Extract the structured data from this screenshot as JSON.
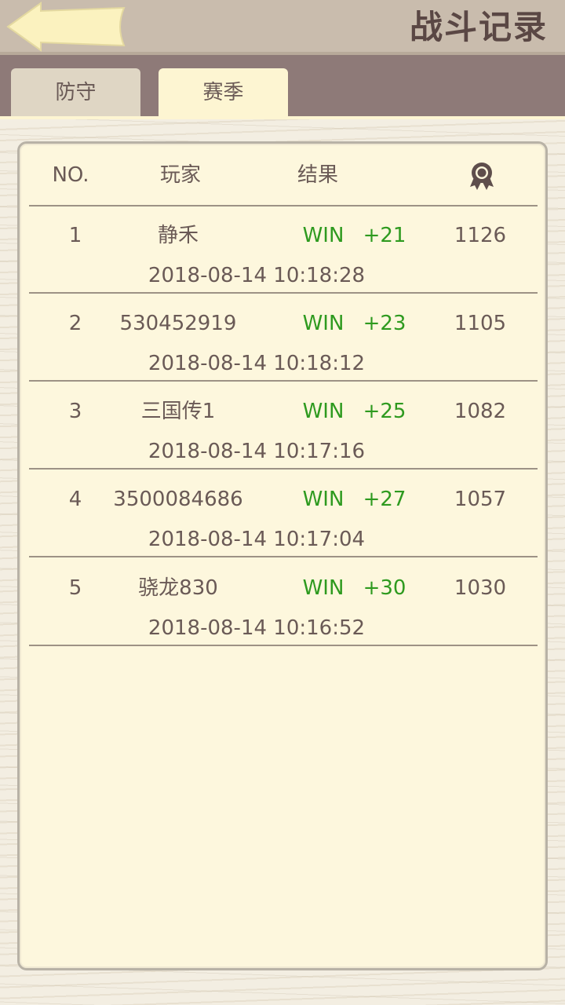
{
  "header": {
    "title": "战斗记录",
    "back_icon": "back-arrow-icon"
  },
  "tabs": [
    {
      "label": "防守",
      "selected": false
    },
    {
      "label": "赛季",
      "selected": true
    }
  ],
  "table": {
    "columns": [
      "NO.",
      "玩家",
      "结果"
    ],
    "score_column_icon": "medal-icon",
    "rows": [
      {
        "no": "1",
        "player": "静禾",
        "result": "WIN",
        "points": "+21",
        "score": "1126",
        "time": "2018-08-14 10:18:28"
      },
      {
        "no": "2",
        "player": "530452919",
        "result": "WIN",
        "points": "+23",
        "score": "1105",
        "time": "2018-08-14 10:18:12"
      },
      {
        "no": "3",
        "player": "三国传1",
        "result": "WIN",
        "points": "+25",
        "score": "1082",
        "time": "2018-08-14 10:17:16"
      },
      {
        "no": "4",
        "player": "3500084686",
        "result": "WIN",
        "points": "+27",
        "score": "1057",
        "time": "2018-08-14 10:17:04"
      },
      {
        "no": "5",
        "player": "骁龙830",
        "result": "WIN",
        "points": "+30",
        "score": "1030",
        "time": "2018-08-14 10:16:52"
      }
    ]
  },
  "colors": {
    "win": "#2e9a1f",
    "text": "#6a5a56",
    "header_bg": "#c9bcad",
    "tabbar_bg": "#8e7a78",
    "panel_bg": "#fdf7dd"
  }
}
